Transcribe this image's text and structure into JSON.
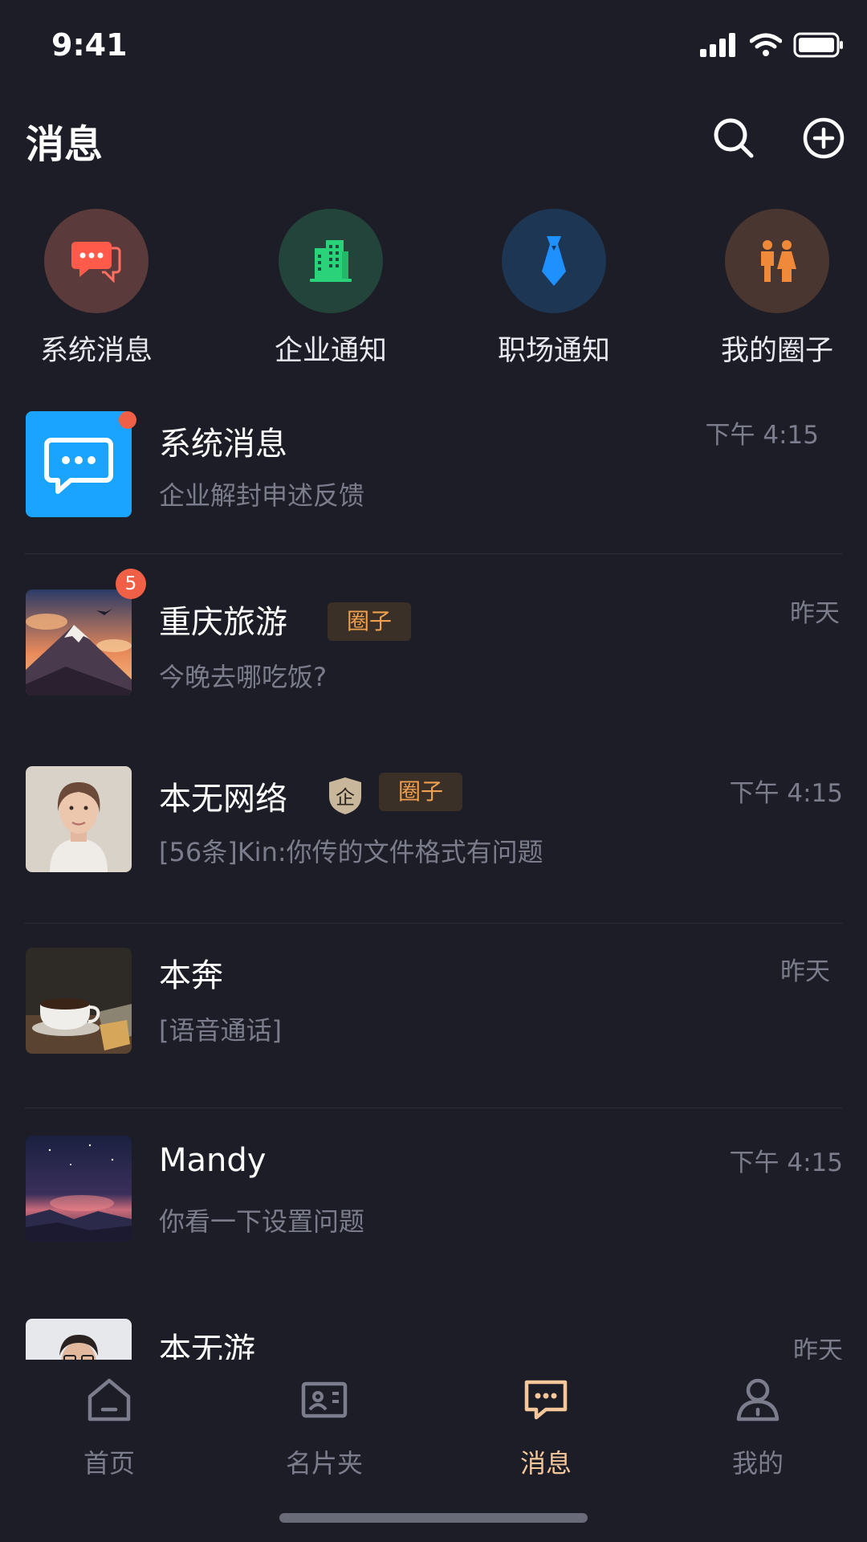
{
  "status": {
    "time": "9:41"
  },
  "header": {
    "title": "消息"
  },
  "quick": [
    {
      "label": "系统消息",
      "icon": "chat-bubbles-icon",
      "color": "#5a3a3a",
      "accent": "#ff5a4a"
    },
    {
      "label": "企业通知",
      "icon": "building-icon",
      "color": "#22443a",
      "accent": "#2ad27a"
    },
    {
      "label": "职场通知",
      "icon": "tie-icon",
      "color": "#1d3654",
      "accent": "#1e90ff"
    },
    {
      "label": "我的圈子",
      "icon": "people-icon",
      "color": "#4a3630",
      "accent": "#f08a3a"
    }
  ],
  "messages": [
    {
      "name": "系统消息",
      "preview": "企业解封申述反馈",
      "time": "下午 4:15",
      "unread": true
    },
    {
      "name": "重庆旅游",
      "tag": "圈子",
      "preview": "今晚去哪吃饭?",
      "time": "昨天",
      "badge": "5"
    },
    {
      "name": "本无网络",
      "ent": "企",
      "tag": "圈子",
      "preview": "[56条]Kin:你传的文件格式有问题",
      "time": "下午 4:15"
    },
    {
      "name": "本奔",
      "preview": "[语音通话]",
      "time": "昨天"
    },
    {
      "name": "Mandy",
      "preview": "你看一下设置问题",
      "time": "下午 4:15"
    },
    {
      "name": "本无游",
      "time": "昨天"
    }
  ],
  "tabs": [
    {
      "label": "首页",
      "icon": "home-icon"
    },
    {
      "label": "名片夹",
      "icon": "card-icon"
    },
    {
      "label": "消息",
      "icon": "message-icon",
      "active": true
    },
    {
      "label": "我的",
      "icon": "profile-icon"
    }
  ],
  "colors": {
    "background": "#1c1d26",
    "accent": "#f5c79b",
    "tag_bg": "#3a3028",
    "tag_text": "#f0a04e"
  }
}
